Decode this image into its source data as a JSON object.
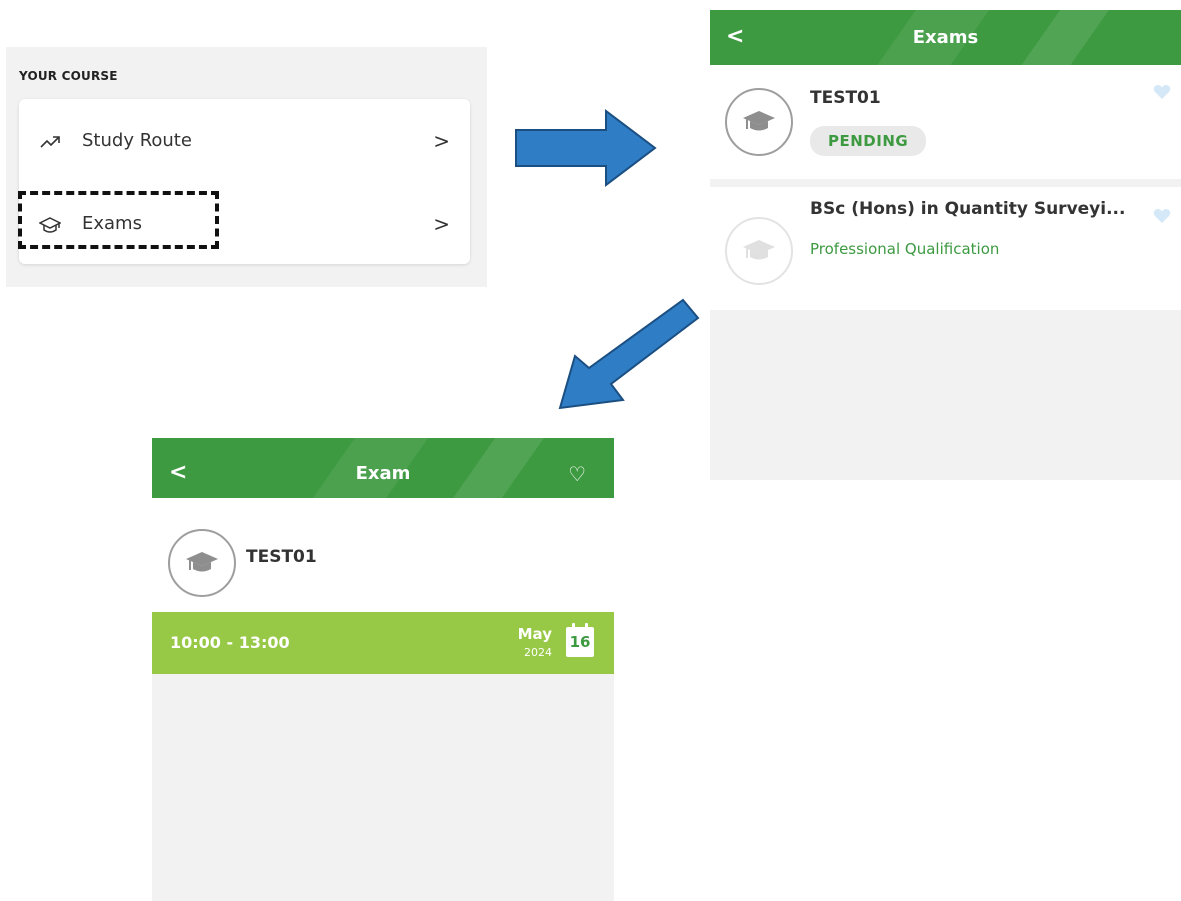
{
  "course": {
    "heading": "YOUR COURSE",
    "items": [
      {
        "label": "Study Route",
        "icon": "trending-up-icon"
      },
      {
        "label": "Exams",
        "icon": "graduation-cap-icon"
      }
    ],
    "chevron": ">"
  },
  "exams_list": {
    "title": "Exams",
    "back": "<",
    "items": [
      {
        "name": "TEST01",
        "status": "PENDING"
      },
      {
        "name": "BSc (Hons) in Quantity Surveyi...",
        "subtitle": "Professional Qualification"
      }
    ]
  },
  "exam_detail": {
    "title": "Exam",
    "back": "<",
    "fav": "♡",
    "name": "TEST01",
    "time": "10:00 - 13:00",
    "month": "May",
    "year": "2024",
    "day": "16"
  },
  "colors": {
    "header_green": "#3d9a41",
    "time_bar_green": "#97c947",
    "arrow_blue": "#2f7dc5",
    "heart_light_blue": "#d4e8f7"
  }
}
